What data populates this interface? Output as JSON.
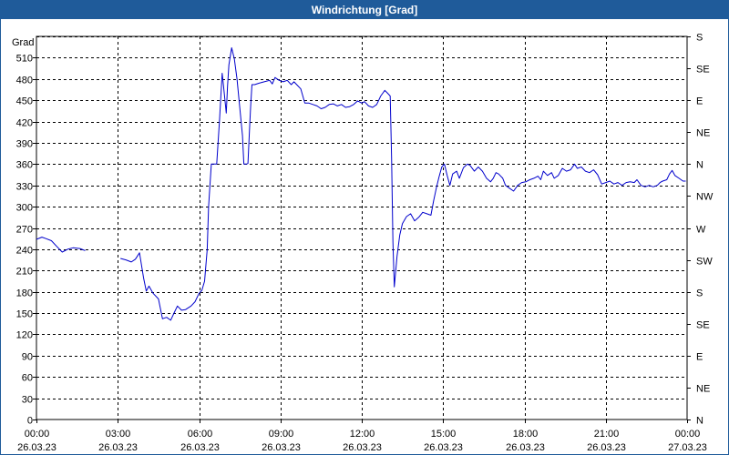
{
  "window": {
    "title": "Windrichtung [Grad]"
  },
  "chart_data": {
    "type": "line",
    "title": "Windrichtung [Grad]",
    "ylabel": "Grad",
    "x_unit": "hours since 26.03.23 00:00",
    "x_range": [
      0,
      24
    ],
    "y_range": [
      0,
      540
    ],
    "y_ticks": [
      0,
      30,
      60,
      90,
      120,
      150,
      180,
      210,
      240,
      270,
      300,
      330,
      360,
      390,
      420,
      450,
      480,
      510
    ],
    "y2_ticks": [
      {
        "value": 0,
        "label": "N"
      },
      {
        "value": 45,
        "label": "NE"
      },
      {
        "value": 90,
        "label": "E"
      },
      {
        "value": 135,
        "label": "SE"
      },
      {
        "value": 180,
        "label": "S"
      },
      {
        "value": 225,
        "label": "SW"
      },
      {
        "value": 270,
        "label": "W"
      },
      {
        "value": 315,
        "label": "NW"
      },
      {
        "value": 360,
        "label": "N"
      },
      {
        "value": 405,
        "label": "NE"
      },
      {
        "value": 450,
        "label": "E"
      },
      {
        "value": 495,
        "label": "SE"
      },
      {
        "value": 540,
        "label": "S"
      }
    ],
    "x_ticks": [
      {
        "h": 0,
        "time": "00:00",
        "date": "26.03.23"
      },
      {
        "h": 3,
        "time": "03:00",
        "date": "26.03.23"
      },
      {
        "h": 6,
        "time": "06:00",
        "date": "26.03.23"
      },
      {
        "h": 9,
        "time": "09:00",
        "date": "26.03.23"
      },
      {
        "h": 12,
        "time": "12:00",
        "date": "26.03.23"
      },
      {
        "h": 15,
        "time": "15:00",
        "date": "26.03.23"
      },
      {
        "h": 18,
        "time": "18:00",
        "date": "26.03.23"
      },
      {
        "h": 21,
        "time": "21:00",
        "date": "26.03.23"
      },
      {
        "h": 24,
        "time": "00:00",
        "date": "27.03.23"
      }
    ],
    "grid": true,
    "colors": {
      "line": "#0000cc",
      "grid": "#000000",
      "frame": "#1f5b9a"
    },
    "series": [
      {
        "name": "",
        "segments": [
          [
            [
              0,
              254
            ],
            [
              0.2,
              257
            ],
            [
              0.35,
              255
            ],
            [
              0.55,
              252
            ],
            [
              0.75,
              244
            ],
            [
              0.95,
              236
            ],
            [
              1.15,
              240
            ],
            [
              1.35,
              242
            ],
            [
              1.6,
              241
            ],
            [
              1.8,
              238
            ]
          ],
          [
            [
              3.1,
              227
            ],
            [
              3.3,
              225
            ],
            [
              3.5,
              222
            ],
            [
              3.65,
              226
            ],
            [
              3.8,
              235
            ],
            [
              3.95,
              200
            ],
            [
              4.05,
              181
            ],
            [
              4.15,
              188
            ],
            [
              4.3,
              178
            ],
            [
              4.5,
              170
            ],
            [
              4.65,
              142
            ],
            [
              4.8,
              144
            ],
            [
              4.95,
              140
            ],
            [
              5.1,
              152
            ],
            [
              5.2,
              160
            ],
            [
              5.35,
              154
            ],
            [
              5.5,
              155
            ],
            [
              5.7,
              160
            ],
            [
              5.85,
              166
            ],
            [
              6.0,
              178
            ],
            [
              6.1,
              182
            ],
            [
              6.2,
              195
            ],
            [
              6.3,
              240
            ],
            [
              6.35,
              300
            ],
            [
              6.45,
              360
            ],
            [
              6.55,
              360
            ],
            [
              6.65,
              360
            ],
            [
              6.75,
              420
            ],
            [
              6.85,
              488
            ],
            [
              6.9,
              470
            ],
            [
              7.0,
              432
            ],
            [
              7.05,
              470
            ],
            [
              7.1,
              500
            ],
            [
              7.2,
              524
            ],
            [
              7.3,
              508
            ],
            [
              7.4,
              480
            ],
            [
              7.5,
              440
            ],
            [
              7.6,
              400
            ],
            [
              7.65,
              360
            ],
            [
              7.75,
              360
            ],
            [
              7.8,
              361
            ],
            [
              7.85,
              400
            ],
            [
              7.9,
              440
            ],
            [
              7.95,
              472
            ],
            [
              8.05,
              472
            ],
            [
              8.2,
              474
            ],
            [
              8.4,
              476
            ],
            [
              8.6,
              478
            ],
            [
              8.7,
              473
            ],
            [
              8.8,
              482
            ],
            [
              8.95,
              478
            ],
            [
              9.1,
              476
            ],
            [
              9.25,
              478
            ],
            [
              9.4,
              472
            ],
            [
              9.5,
              476
            ],
            [
              9.6,
              472
            ],
            [
              9.75,
              466
            ],
            [
              9.9,
              446
            ],
            [
              10.05,
              446
            ],
            [
              10.2,
              444
            ],
            [
              10.35,
              442
            ],
            [
              10.5,
              438
            ],
            [
              10.65,
              440
            ],
            [
              10.8,
              444
            ],
            [
              10.95,
              445
            ],
            [
              11.1,
              442
            ],
            [
              11.25,
              444
            ],
            [
              11.4,
              440
            ],
            [
              11.55,
              441
            ],
            [
              11.7,
              444
            ],
            [
              11.85,
              449
            ],
            [
              12.0,
              446
            ],
            [
              12.1,
              448
            ],
            [
              12.25,
              442
            ],
            [
              12.4,
              440
            ],
            [
              12.55,
              444
            ],
            [
              12.7,
              456
            ],
            [
              12.85,
              464
            ],
            [
              12.95,
              460
            ],
            [
              13.05,
              456
            ],
            [
              13.1,
              370
            ],
            [
              13.15,
              250
            ],
            [
              13.2,
              187
            ],
            [
              13.3,
              230
            ],
            [
              13.4,
              260
            ],
            [
              13.5,
              276
            ],
            [
              13.65,
              286
            ],
            [
              13.8,
              290
            ],
            [
              13.95,
              280
            ],
            [
              14.1,
              285
            ],
            [
              14.25,
              292
            ],
            [
              14.4,
              290
            ],
            [
              14.55,
              288
            ],
            [
              14.65,
              308
            ],
            [
              14.75,
              326
            ],
            [
              14.85,
              342
            ],
            [
              14.95,
              356
            ],
            [
              15.05,
              360
            ],
            [
              15.15,
              344
            ],
            [
              15.25,
              330
            ],
            [
              15.35,
              346
            ],
            [
              15.5,
              350
            ],
            [
              15.6,
              340
            ],
            [
              15.75,
              355
            ],
            [
              15.9,
              360
            ],
            [
              16.0,
              358
            ],
            [
              16.15,
              350
            ],
            [
              16.3,
              356
            ],
            [
              16.45,
              350
            ],
            [
              16.6,
              340
            ],
            [
              16.75,
              335
            ],
            [
              16.85,
              340
            ],
            [
              16.95,
              348
            ],
            [
              17.05,
              346
            ],
            [
              17.2,
              340
            ],
            [
              17.3,
              330
            ],
            [
              17.45,
              326
            ],
            [
              17.6,
              322
            ],
            [
              17.75,
              330
            ],
            [
              17.9,
              334
            ],
            [
              18.05,
              335
            ],
            [
              18.2,
              338
            ],
            [
              18.35,
              340
            ],
            [
              18.5,
              343
            ],
            [
              18.6,
              338
            ],
            [
              18.7,
              350
            ],
            [
              18.85,
              344
            ],
            [
              19.0,
              348
            ],
            [
              19.1,
              340
            ],
            [
              19.25,
              344
            ],
            [
              19.4,
              354
            ],
            [
              19.55,
              350
            ],
            [
              19.7,
              352
            ],
            [
              19.85,
              360
            ],
            [
              19.95,
              354
            ],
            [
              20.1,
              356
            ],
            [
              20.25,
              350
            ],
            [
              20.4,
              348
            ],
            [
              20.55,
              352
            ],
            [
              20.7,
              345
            ],
            [
              20.85,
              332
            ],
            [
              21.0,
              334
            ],
            [
              21.15,
              336
            ],
            [
              21.3,
              332
            ],
            [
              21.45,
              334
            ],
            [
              21.6,
              330
            ],
            [
              21.75,
              334
            ],
            [
              21.9,
              335
            ],
            [
              22.05,
              334
            ],
            [
              22.15,
              338
            ],
            [
              22.3,
              330
            ],
            [
              22.45,
              328
            ],
            [
              22.6,
              330
            ],
            [
              22.75,
              328
            ],
            [
              22.9,
              330
            ],
            [
              23.0,
              334
            ],
            [
              23.1,
              336
            ],
            [
              23.25,
              338
            ],
            [
              23.35,
              346
            ],
            [
              23.45,
              351
            ],
            [
              23.55,
              344
            ],
            [
              23.7,
              340
            ],
            [
              23.85,
              336
            ],
            [
              23.95,
              336
            ]
          ]
        ]
      }
    ]
  }
}
